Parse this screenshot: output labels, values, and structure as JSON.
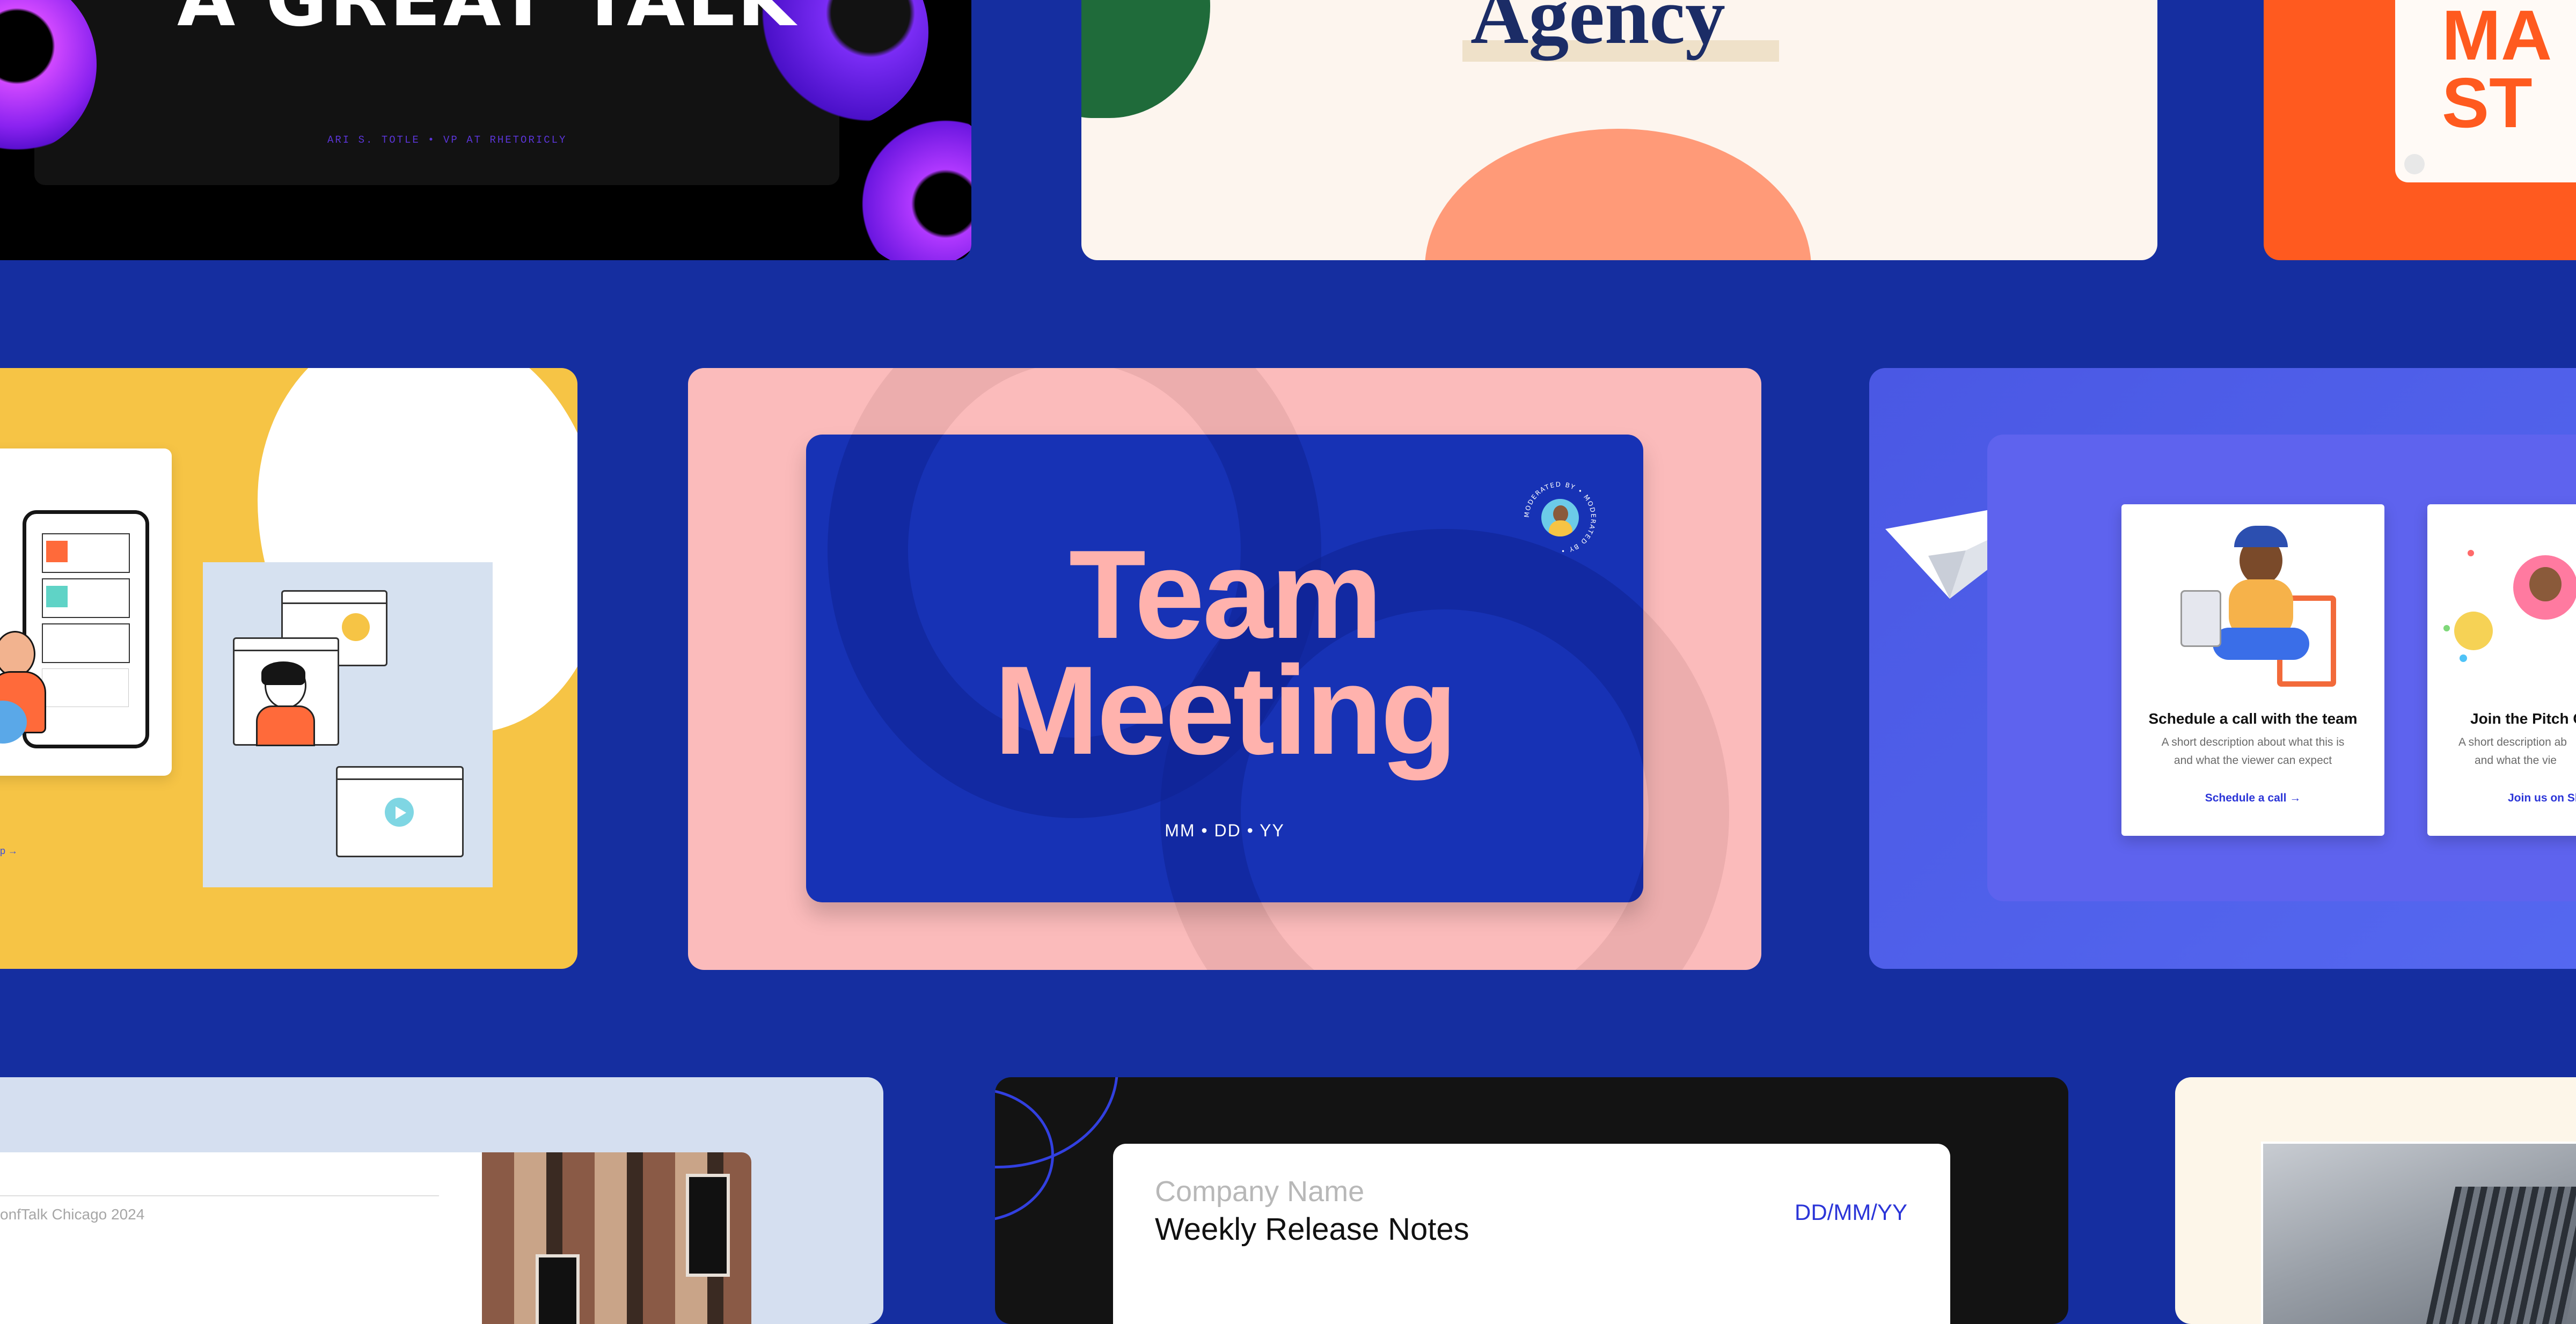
{
  "colors": {
    "background": "#152ea0",
    "team_card_bg": "#fbbbbb",
    "team_inner_bg": "#1732b5",
    "team_title": "#ffb2ad",
    "agency_bg": "#fdf5ee",
    "agency_title": "#1b2c66",
    "orange": "#ff5a1f",
    "pitch_bg": "#4c5ae6",
    "yellow": "#f6c445",
    "release_dark": "#131313",
    "release_link": "#2b35d8"
  },
  "talk_slide": {
    "title": "A GREAT TALK",
    "byline": "ARI S. TOTLE • VP AT RHETORICLY"
  },
  "agency_slide": {
    "title": "Agency"
  },
  "orange_slide": {
    "line1": "MA",
    "line2": "ST"
  },
  "team_meeting": {
    "line1": "Team",
    "line2": "Meeting",
    "date": "MM • DD • YY",
    "badge_text": "MODERATED BY • MODERATED BY •"
  },
  "pitch_slide": {
    "cards": [
      {
        "title": "Schedule a call with the team",
        "desc1": "A short description about what this is",
        "desc2": "and what the viewer can expect",
        "link": "Schedule a call →"
      },
      {
        "title": "Join the Pitch C",
        "desc1": "A short description ab",
        "desc2": "and what the vie",
        "link": "Join us on Sl"
      }
    ]
  },
  "app_slide": {
    "link": "p →"
  },
  "conf_slide": {
    "caption": "onfTalk Chicago 2024"
  },
  "release_slide": {
    "company": "Company Name",
    "title": "Weekly Release Notes",
    "date": "DD/MM/YY"
  }
}
